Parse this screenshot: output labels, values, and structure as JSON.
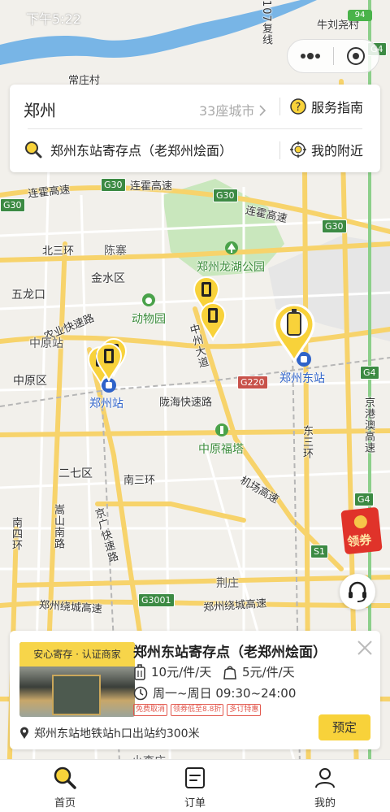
{
  "status_bar": {
    "time": "下午5:22",
    "battery": "94"
  },
  "search_card": {
    "city": "郑州",
    "city_count": "33座城市",
    "service_guide": "服务指南",
    "search_text": "郑州东站寄存点（老郑州烩面）",
    "nearby": "我的附近"
  },
  "map": {
    "labels": {
      "changzhuang": "常庄村",
      "niuliuyao": "牛刘尧村",
      "fuxian": "107复线",
      "lianhuo1": "连霍高速",
      "lianhuo2": "连霍高速",
      "lianhuo3": "连霍高速",
      "beisanhuan": "北三环",
      "chenzhai": "陈寨",
      "jinshui": "金水区",
      "longhu": "郑州龙湖公园",
      "wulongkou": "五龙口",
      "nongye": "农业快速路",
      "zoo": "动物园",
      "zhongyuanzhan": "中原站",
      "zhongzhou": "中州大道",
      "zhongyuanqu": "中原区",
      "zhengzhouzhan": "郑州站",
      "zhengzhoudong": "郑州东站",
      "longhai": "陇海快速路",
      "dongsanhuan": "东三环",
      "jinggangao": "京港澳高速",
      "fuzhuta": "中原福塔",
      "erqi": "二七区",
      "nansanhuan": "南三环",
      "jichang": "机场高速",
      "songshan": "嵩山南路",
      "jingguang": "京广快速路",
      "nansihuan": "南四环",
      "jingzhuang": "荆庄",
      "raocheng1": "郑州绕城高速",
      "raocheng2": "郑州绕城高速",
      "xiao": "小李庄"
    },
    "shields": {
      "g30a": "G30",
      "g30b": "G30",
      "g30c": "G30",
      "g30d": "G30",
      "g4a": "G4",
      "g4b": "G4",
      "g4c": "G4",
      "g220": "G220",
      "g3001": "G3001",
      "s1": "S1"
    },
    "markers": [
      {
        "name": "zhengzhou-station-a",
        "selected": false
      },
      {
        "name": "zhengzhou-station-b",
        "selected": false
      },
      {
        "name": "zhengzhou-station-c",
        "selected": false
      },
      {
        "name": "zhongzhou-north",
        "selected": false
      },
      {
        "name": "zhongzhou-south",
        "selected": false
      },
      {
        "name": "zhengzhou-east",
        "selected": true
      }
    ]
  },
  "coupon": {
    "label": "领券"
  },
  "detail_card": {
    "photo_tag": "安心寄存 · 认证商家",
    "title": "郑州东站寄存点（老郑州烩面）",
    "price_large": "10元/件/天",
    "price_small": "5元/件/天",
    "hours": "周一~周日 09:30~24:00",
    "tags": [
      "免费取消",
      "领券低至8.8折",
      "多订特惠"
    ],
    "address": "郑州东站地铁站h口出站约300米",
    "book_label": "预定"
  },
  "tabbar": {
    "home": "首页",
    "orders": "订单",
    "mine": "我的"
  },
  "colors": {
    "accent": "#f8d23a",
    "highway_green": "#3c8a43",
    "road_yellow": "#f7d36b",
    "park_green": "#c9e7bd",
    "river_blue": "#78b5e6"
  }
}
